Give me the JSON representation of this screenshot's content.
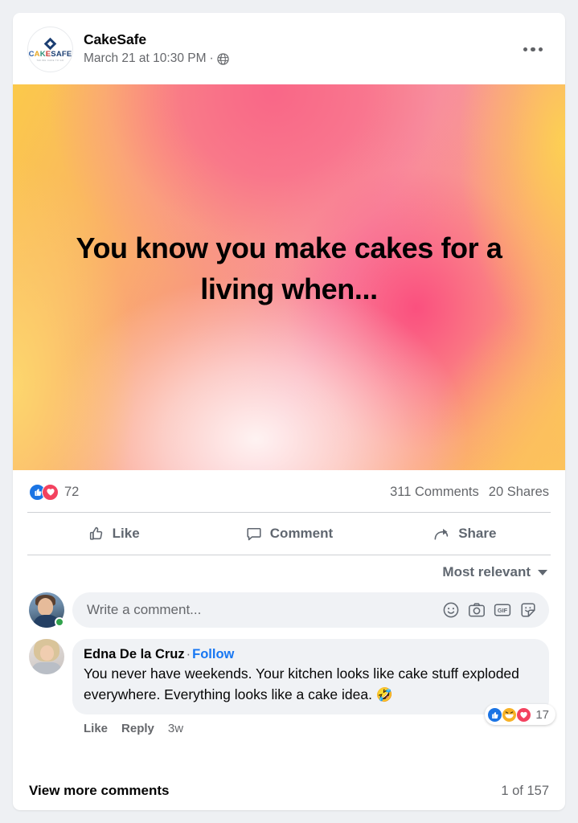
{
  "post": {
    "page_name": "CakeSafe",
    "timestamp": "March 21 at 10:30 PM",
    "meta_separator": "·",
    "privacy_icon": "globe-icon",
    "more_icon": "ellipsis-icon",
    "logo": {
      "letters": [
        "C",
        "A",
        "K",
        "E",
        "SAFE"
      ],
      "tagline": "TAKING CAKE TO GO"
    }
  },
  "image": {
    "text": "You know you make cakes for a living when...",
    "gradient": {
      "top_left": "#FBC94A",
      "top_center": "#F96588",
      "top_right": "#FCD34D",
      "center_right": "#FA467D",
      "bottom_center": "#FFF5F2",
      "bottom_left": "#FDD86E",
      "bottom_right": "#FCBE5F"
    },
    "text_color": "#000000"
  },
  "stats": {
    "reaction_icons": [
      "like-icon",
      "love-icon"
    ],
    "reaction_count": "72",
    "comments": "311 Comments",
    "shares": "20 Shares"
  },
  "actions": {
    "like": "Like",
    "comment": "Comment",
    "share": "Share"
  },
  "sort": {
    "label": "Most relevant",
    "caret_icon": "chevron-down-icon"
  },
  "composer": {
    "placeholder": "Write a comment...",
    "icons": [
      "emoji-icon",
      "camera-icon",
      "gif-icon",
      "sticker-icon"
    ],
    "online_status": true
  },
  "comment": {
    "author": "Edna De la Cruz",
    "separator": "·",
    "follow_label": "Follow",
    "text": "You never have weekends. Your kitchen looks like cake stuff exploded everywhere. Everything looks like a cake idea. ",
    "emoji": "🤣",
    "reaction_icons": [
      "like-icon",
      "haha-icon",
      "love-icon"
    ],
    "reaction_count": "17",
    "like_label": "Like",
    "reply_label": "Reply",
    "time": "3w"
  },
  "footer": {
    "view_more": "View more comments",
    "pagination": "1 of 157"
  },
  "colors": {
    "facebook_blue": "#1877f2",
    "like_blue": "#1b74e4",
    "love_red": "#f3425f",
    "haha_yellow": "#f7b125",
    "online_green": "#31a24c",
    "text_primary": "#050505",
    "text_secondary": "#65676b",
    "surface": "#f0f2f5"
  }
}
